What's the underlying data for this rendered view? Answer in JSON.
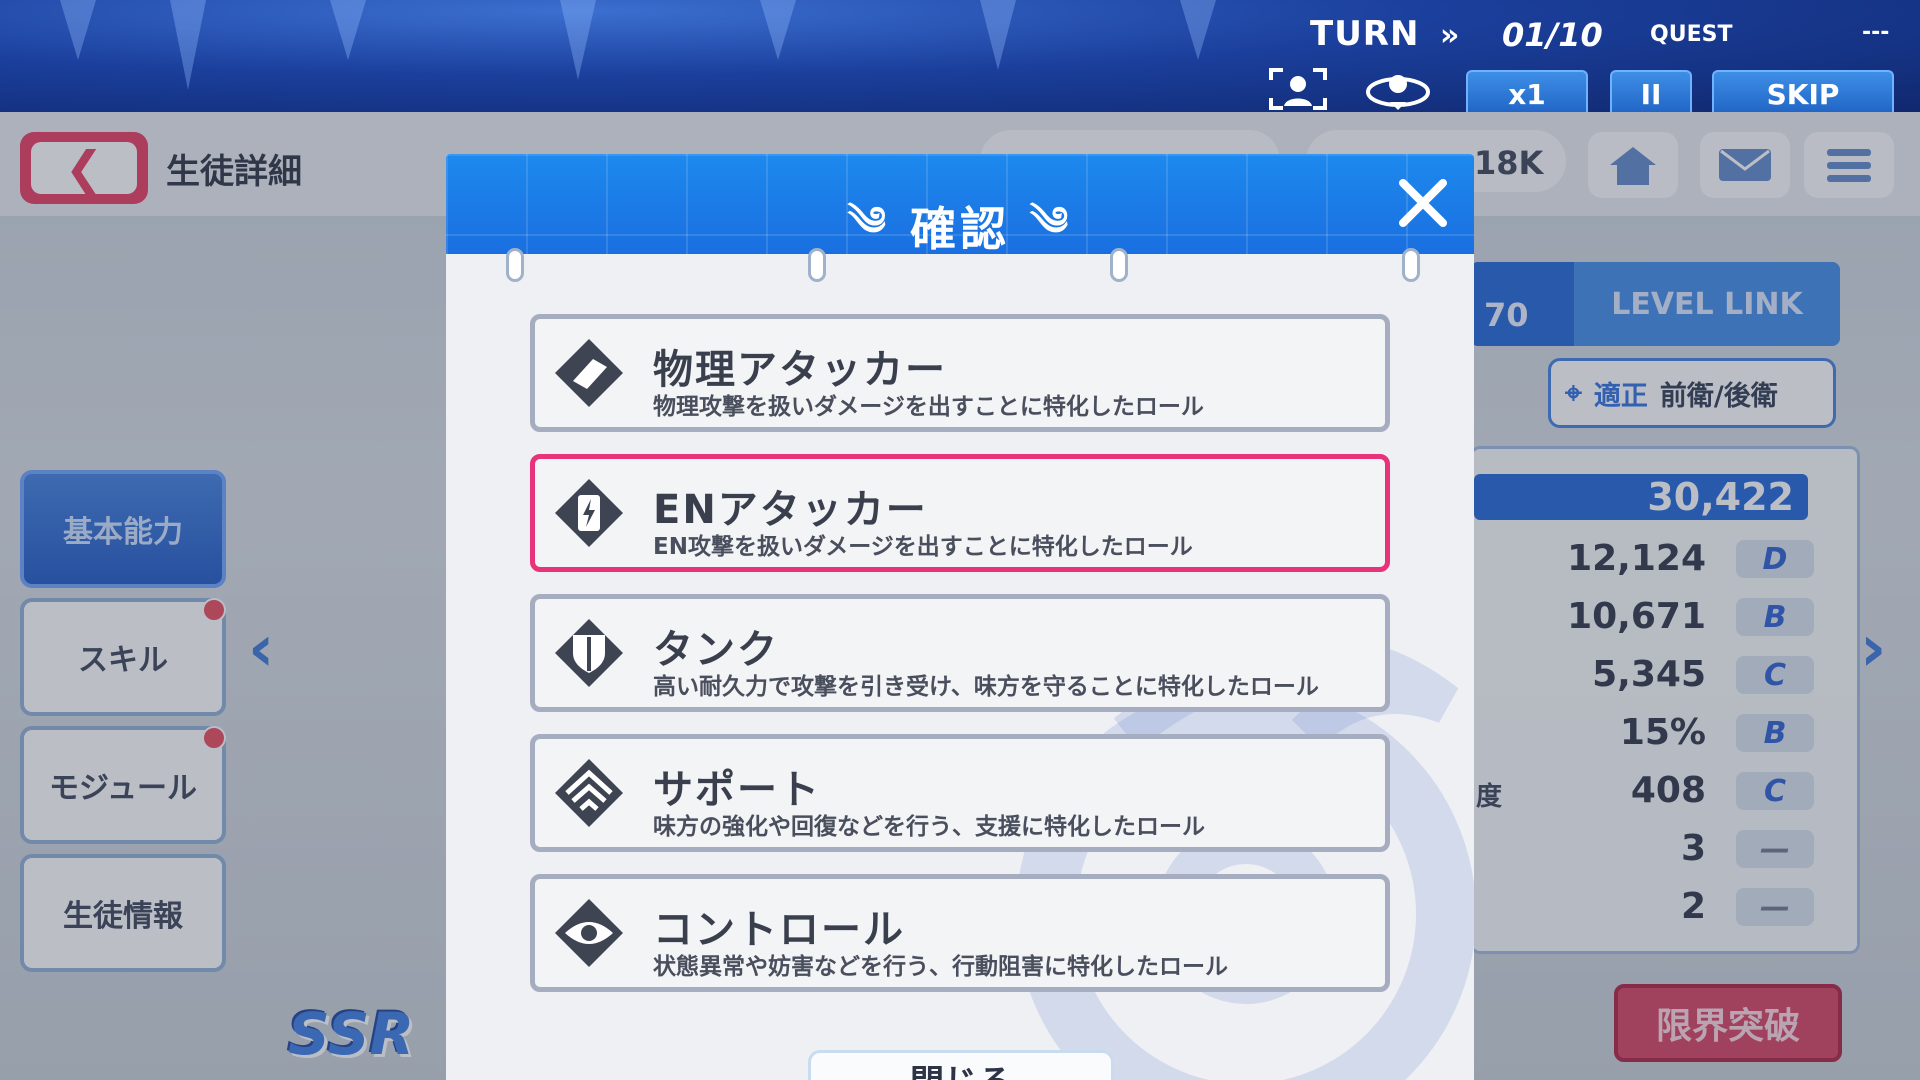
{
  "hud": {
    "turn_label": "TURN",
    "turn_arrows": "»",
    "turn_value": "01/10",
    "quest_label": "QUEST",
    "quest_value": "---",
    "speed_label": "x1",
    "pause_label": "II",
    "skip_label": "SKIP"
  },
  "screen": {
    "title": "生徒詳細",
    "currency_text": "18K",
    "side_tabs": [
      {
        "label": "基本能力"
      },
      {
        "label": "スキル"
      },
      {
        "label": "モジュール"
      },
      {
        "label": "生徒情報"
      }
    ],
    "level": "70",
    "level_link": "LEVEL LINK",
    "aptitude_label": "適正",
    "aptitude_value": "前衛/後衛",
    "total_stat": "30,422",
    "stats": [
      {
        "label": "",
        "value": "12,124",
        "rank": "D"
      },
      {
        "label": "",
        "value": "10,671",
        "rank": "B"
      },
      {
        "label": "",
        "value": "5,345",
        "rank": "C"
      },
      {
        "label": "",
        "value": "15%",
        "rank": "B"
      },
      {
        "label": "度",
        "value": "408",
        "rank": "C"
      },
      {
        "label": "",
        "value": "3",
        "rank": "—"
      },
      {
        "label": "",
        "value": "2",
        "rank": "—"
      }
    ],
    "limit_break": "限界突破",
    "rarity": "SSR"
  },
  "modal": {
    "title": "確認",
    "roles": [
      {
        "name": "物理アタッカー",
        "desc": "物理攻撃を扱いダメージを出すことに特化したロール",
        "icon": "physical-attacker-icon"
      },
      {
        "name": "ENアタッカー",
        "desc": "EN攻撃を扱いダメージを出すことに特化したロール",
        "icon": "en-attacker-icon"
      },
      {
        "name": "タンク",
        "desc": "高い耐久力で攻撃を引き受け、味方を守ることに特化したロール",
        "icon": "tank-icon"
      },
      {
        "name": "サポート",
        "desc": "味方の強化や回復などを行う、支援に特化したロール",
        "icon": "support-icon"
      },
      {
        "name": "コントロール",
        "desc": "状態異常や妨害などを行う、行動阻害に特化したロール",
        "icon": "control-icon"
      }
    ],
    "close_label": "閉じる"
  },
  "colors": {
    "accent_blue": "#1a6fe0",
    "selected_border": "#e8337a",
    "card_border": "#a7adc0"
  }
}
